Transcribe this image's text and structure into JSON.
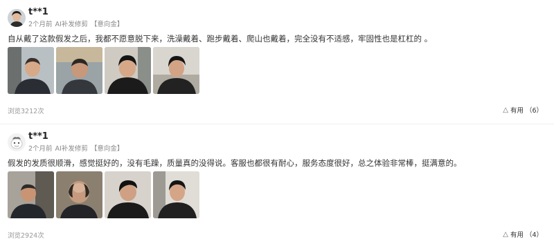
{
  "reviews": [
    {
      "user": "t**1",
      "time": "2个月前",
      "service": "AI补发修剪",
      "tag": "【意向金】",
      "content": "自从戴了这款假发之后，我都不愿意脱下来，洗澡戴着、跑步戴着、爬山也戴着，完全没有不适感，牢固性也是杠杠的 。",
      "photos": [
        "before-side-photo",
        "before-back-photo",
        "after-front-photo",
        "after-side-photo"
      ],
      "views": "浏览3212次",
      "useful_label": "有用",
      "useful_count": "（6）",
      "avatar_icon": "user-photo-avatar"
    },
    {
      "user": "t**1",
      "time": "2个月前",
      "service": "AI补发修剪",
      "tag": "【意向金】",
      "content": "假发的发质很顺滑，感觉挺好的，没有毛躁，质量真的没得说。客服也都很有耐心，服务态度很好，总之体验非常棒，挺满意的。",
      "photos": [
        "before-side-photo",
        "before-crown-photo",
        "after-side-photo",
        "after-front-photo"
      ],
      "views": "浏览2924次",
      "useful_label": "有用",
      "useful_count": "（4）",
      "avatar_icon": "default-cartoon-avatar"
    }
  ]
}
